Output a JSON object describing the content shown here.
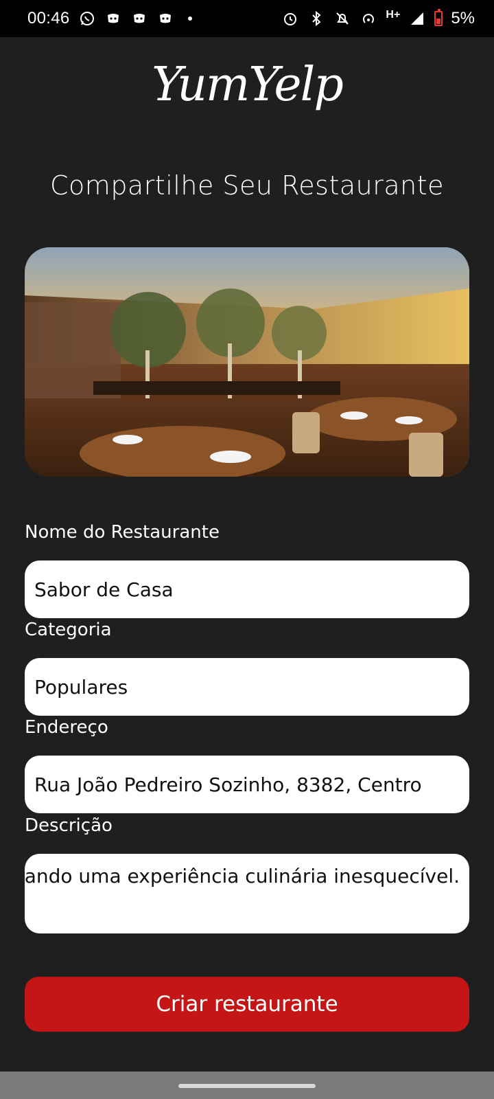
{
  "status_bar": {
    "time": "00:46",
    "network": "H+",
    "battery": "5%",
    "left_icons": [
      "whatsapp-icon",
      "discord-icon",
      "discord-icon",
      "discord-icon"
    ],
    "right_icons": [
      "alarm-icon",
      "bluetooth-icon",
      "notifications-off-icon",
      "hotspot-icon",
      "signal-icon",
      "battery-low-icon"
    ]
  },
  "logo": "YumYelp",
  "page_title": "Compartilhe Seu Restaurante",
  "form": {
    "name": {
      "label": "Nome do Restaurante",
      "value": "Sabor de Casa"
    },
    "category": {
      "label": "Categoria",
      "value": "Populares"
    },
    "address": {
      "label": "Endereço",
      "value": "Rua João Pedreiro Sozinho, 8382, Centro"
    },
    "description": {
      "label": "Descrição",
      "value": "ionando uma experiência culinária inesquecível."
    }
  },
  "submit_label": "Criar restaurante",
  "colors": {
    "background": "#1f1f1f",
    "button": "#c41616",
    "field": "#ffffff"
  }
}
